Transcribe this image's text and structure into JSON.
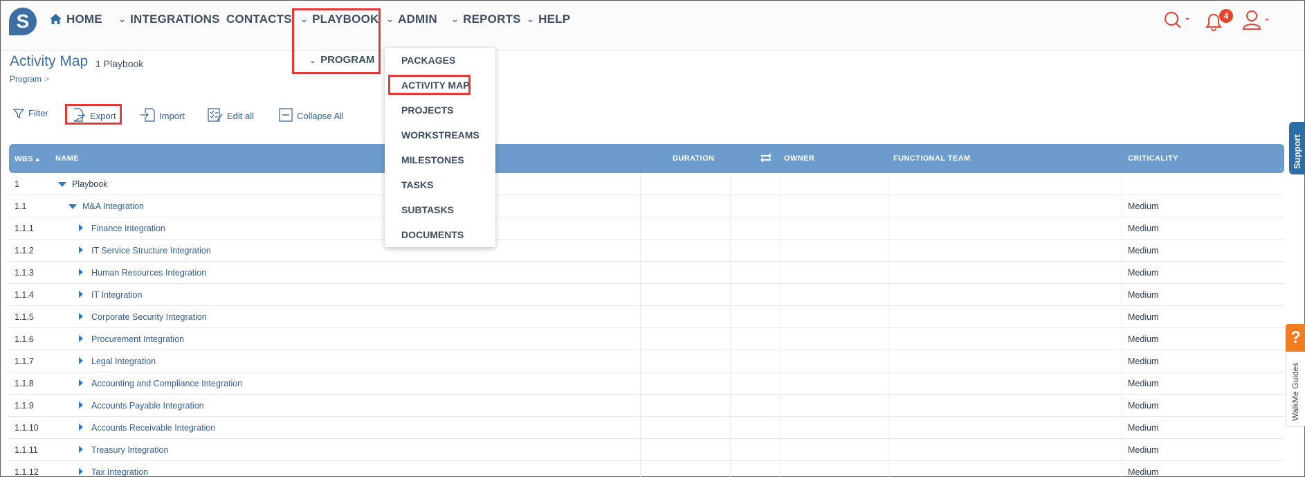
{
  "nav": {
    "items": [
      {
        "label": "HOME",
        "icon": "home-icon"
      },
      {
        "label": "INTEGRATIONS",
        "icon": "chevron-down-icon"
      },
      {
        "label": "CONTACTS"
      },
      {
        "label": "PLAYBOOK",
        "icon": "chevron-down-icon"
      },
      {
        "label": "ADMIN",
        "icon": "chevron-down-icon"
      },
      {
        "label": "REPORTS",
        "icon": "chevron-down-icon"
      },
      {
        "label": "HELP",
        "icon": "chevron-down-icon"
      }
    ],
    "notification_count": "4",
    "sub_item": "PROGRAM"
  },
  "dropdown": {
    "items": [
      "PACKAGES",
      "ACTIVITY MAP",
      "PROJECTS",
      "WORKSTREAMS",
      "MILESTONES",
      "TASKS",
      "SUBTASKS",
      "DOCUMENTS"
    ]
  },
  "page": {
    "title": "Activity Map",
    "subtitle": "1 Playbook",
    "breadcrumb": "Program",
    "breadcrumb_sep": ">"
  },
  "toolbar": {
    "filter": "Filter",
    "export": "Export",
    "import": "Import",
    "edit_all": "Edit all",
    "collapse_all": "Collapse All"
  },
  "table": {
    "headers": {
      "wbs": "WBS",
      "name": "NAME",
      "duration": "DURATION",
      "owner": "OWNER",
      "functional_team": "FUNCTIONAL TEAM",
      "criticality": "CRITICALITY"
    },
    "rows": [
      {
        "wbs": "1",
        "name": "Playbook",
        "criticality": ""
      },
      {
        "wbs": "1.1",
        "name": "M&A Integration",
        "criticality": "Medium"
      },
      {
        "wbs": "1.1.1",
        "name": "Finance Integration",
        "criticality": "Medium"
      },
      {
        "wbs": "1.1.2",
        "name": "IT Service Structure Integration",
        "criticality": "Medium"
      },
      {
        "wbs": "1.1.3",
        "name": "Human Resources Integration",
        "criticality": "Medium"
      },
      {
        "wbs": "1.1.4",
        "name": "IT Integration",
        "criticality": "Medium"
      },
      {
        "wbs": "1.1.5",
        "name": "Corporate Security Integration",
        "criticality": "Medium"
      },
      {
        "wbs": "1.1.6",
        "name": "Procurement Integration",
        "criticality": "Medium"
      },
      {
        "wbs": "1.1.7",
        "name": "Legal Integration",
        "criticality": "Medium"
      },
      {
        "wbs": "1.1.8",
        "name": "Accounting and Compliance Integration",
        "criticality": "Medium"
      },
      {
        "wbs": "1.1.9",
        "name": "Accounts Payable Integration",
        "criticality": "Medium"
      },
      {
        "wbs": "1.1.10",
        "name": "Accounts Receivable Integration",
        "criticality": "Medium"
      },
      {
        "wbs": "1.1.11",
        "name": "Treasury Integration",
        "criticality": "Medium"
      },
      {
        "wbs": "1.1.12",
        "name": "Tax Integration",
        "criticality": "Medium"
      }
    ]
  },
  "side": {
    "support": "Support",
    "walkme_q": "?",
    "walkme": "WalkMe Guides"
  },
  "colors": {
    "accent": "#2d6ea8",
    "table_header": "#6b9ccc",
    "highlight": "#e53935",
    "walkme": "#f07d1f"
  }
}
